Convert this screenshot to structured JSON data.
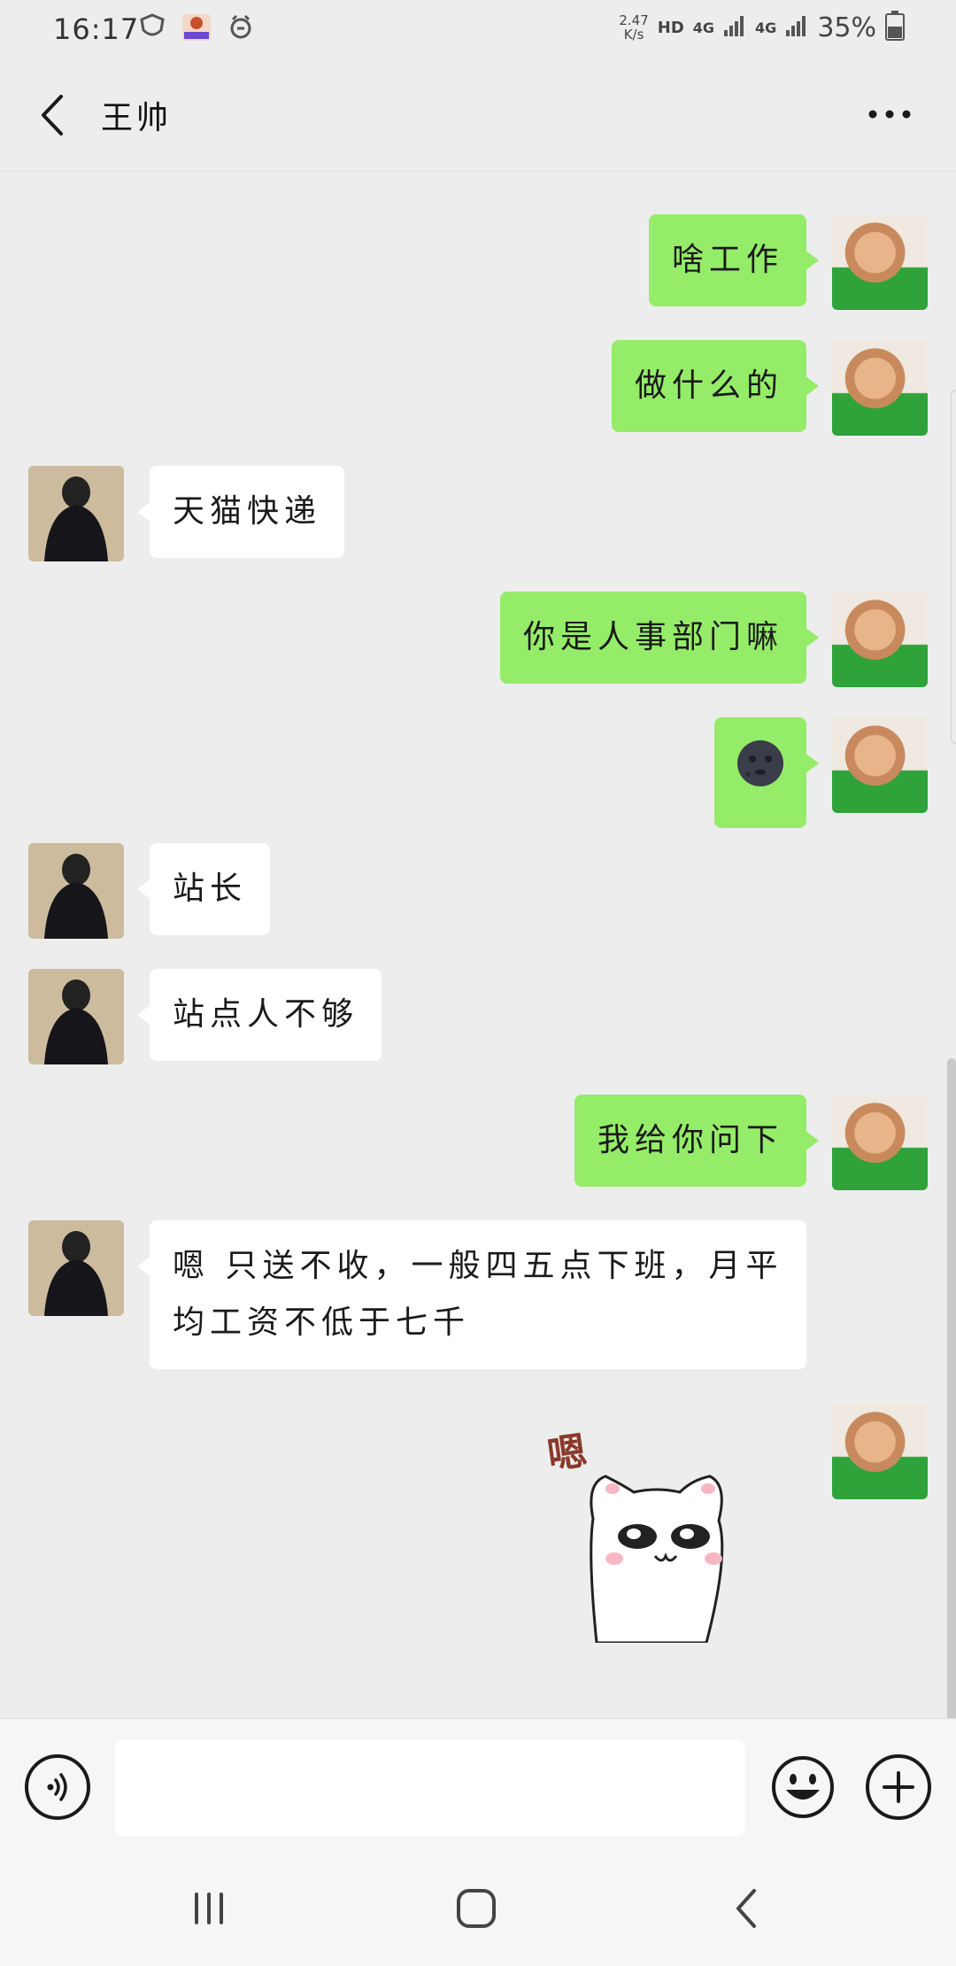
{
  "status_bar": {
    "time": "16:17",
    "net_speed_value": "2.47",
    "net_speed_unit": "K/s",
    "hd": "HD",
    "sig_a": "4G",
    "sig_b": "4G",
    "battery": "35%"
  },
  "header": {
    "title": "王帅"
  },
  "messages": [
    {
      "side": "right",
      "text": "啥工作"
    },
    {
      "side": "right",
      "text": "做什么的"
    },
    {
      "side": "left",
      "text": "天猫快递"
    },
    {
      "side": "right",
      "text": "你是人事部门嘛"
    },
    {
      "side": "right",
      "emoji": "🌚"
    },
    {
      "side": "left",
      "text": "站长"
    },
    {
      "side": "left",
      "text": "站点人不够"
    },
    {
      "side": "right",
      "text": "我给你问下"
    },
    {
      "side": "left",
      "text": "嗯 只送不收，一般四五点下班，月平均工资不低于七千"
    },
    {
      "side": "right",
      "sticker_text": "嗯"
    }
  ],
  "colors": {
    "self_bubble": "#95ec69",
    "other_bubble": "#ffffff",
    "background": "#ededed"
  },
  "icons": {
    "back": "back-arrow-icon",
    "more": "more-dots-icon",
    "voice": "voice-icon",
    "emoji": "emoji-icon",
    "plus": "plus-icon"
  }
}
